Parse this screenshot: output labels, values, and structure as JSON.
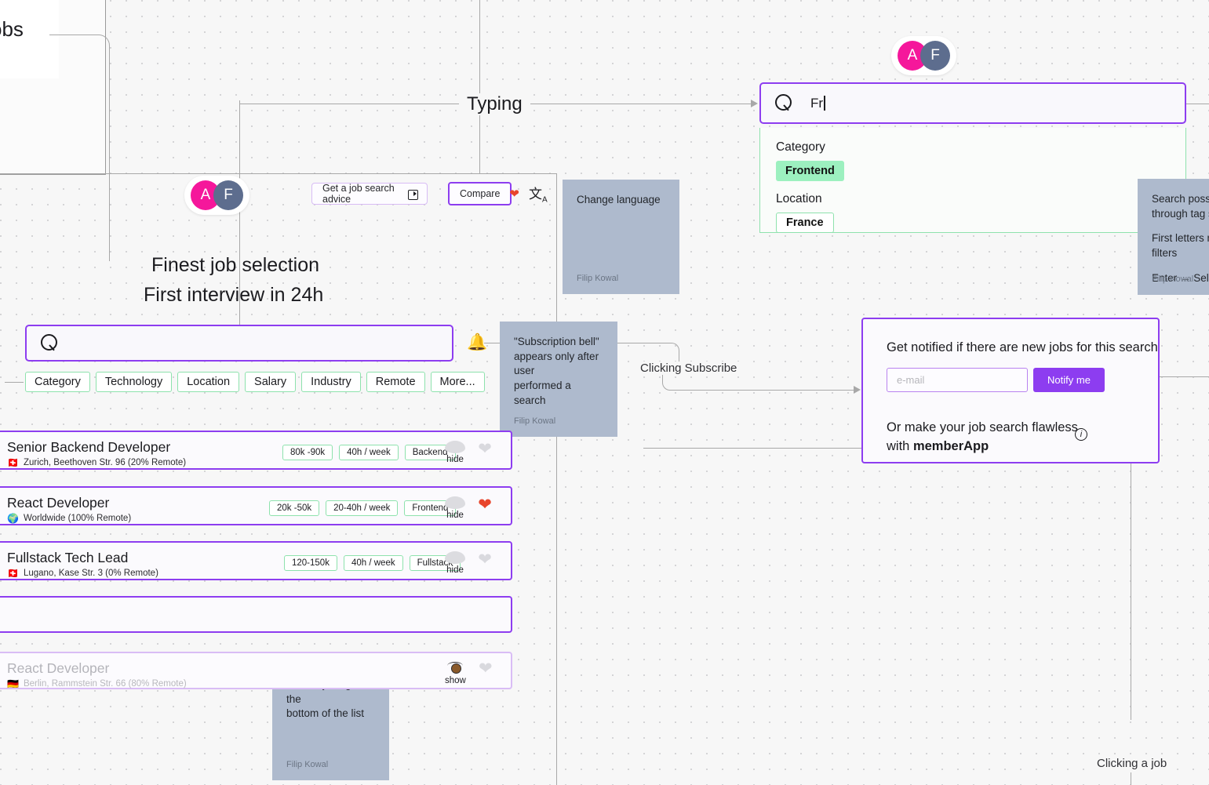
{
  "canvas": {
    "board_type": "design-whiteboard",
    "accent_purple": "#8d3df0",
    "accent_green": "#8ee2ad",
    "sticky_color": "#aebacd",
    "background": "#f7f7f7"
  },
  "corner_card": {
    "text": "obs"
  },
  "flow_labels": {
    "typing": "Typing",
    "clicking_subscribe": "Clicking Subscribe",
    "clicking_a_job": "Clicking a job"
  },
  "avatars": {
    "top": [
      {
        "initial": "A",
        "color": "#f5179b"
      },
      {
        "initial": "F",
        "color": "#5d6d8e"
      }
    ],
    "left": [
      {
        "initial": "A",
        "color": "#f5179b"
      },
      {
        "initial": "F",
        "color": "#5d6d8e"
      }
    ]
  },
  "top_search": {
    "icon": "search-icon",
    "value": "Fr",
    "suggestions": [
      {
        "group": "Category",
        "tag": "Frontend",
        "style": "filled"
      },
      {
        "group": "Location",
        "tag": "France",
        "style": "outline"
      }
    ]
  },
  "headline": {
    "line1": "Finest job selection",
    "line2": "First interview in 24h"
  },
  "toolbar": {
    "advice_label": "Get a job search advice",
    "advice_icon": "video-icon",
    "compare_label": "Compare",
    "compare_icon": "heart-icon",
    "translate_icon": "translate-icon"
  },
  "main_search": {
    "icon": "search-icon",
    "value": "",
    "placeholder": ""
  },
  "filter_chips": [
    "Category",
    "Technology",
    "Location",
    "Salary",
    "Industry",
    "Remote",
    "More..."
  ],
  "bell": {
    "icon": "bell-icon"
  },
  "jobs": [
    {
      "title": "Senior Backend Developer",
      "flag": "🇨🇭",
      "location": "Zurich, Beethoven Str. 96 (20% Remote)",
      "tags": [
        "80k -90k",
        "40h / week",
        "Backend"
      ],
      "action_label": "hide",
      "action_icon": "eye-closed-icon",
      "favorite": false,
      "hidden": false
    },
    {
      "title": "React Developer",
      "flag": "🌍",
      "location": "Worldwide (100% Remote)",
      "tags": [
        "20k -50k",
        "20-40h / week",
        "Frontend"
      ],
      "action_label": "hide",
      "action_icon": "eye-closed-icon",
      "favorite": true,
      "hidden": false
    },
    {
      "title": "Fullstack Tech Lead",
      "flag": "🇨🇭",
      "location": "Lugano, Kase Str. 3 (0% Remote)",
      "tags": [
        "120-150k",
        "40h / week",
        "Fullstack"
      ],
      "action_label": "hide",
      "action_icon": "eye-closed-icon",
      "favorite": false,
      "hidden": false
    },
    {
      "title": "",
      "flag": "",
      "location": "",
      "tags": [],
      "action_label": "",
      "action_icon": "",
      "favorite": false,
      "hidden": false,
      "empty": true
    },
    {
      "title": "React Developer",
      "flag": "🇩🇪",
      "location": "Berlin, Rammstein Str. 66 (80% Remote)",
      "tags": [],
      "action_label": "show",
      "action_icon": "eye-open-icon",
      "favorite": false,
      "hidden": true
    }
  ],
  "notify_panel": {
    "title": "Get notified if there are new jobs for this search",
    "email_placeholder": "e-mail",
    "email_value": "",
    "button_label": "Notify me",
    "sub_line1": "Or make your job search flawless",
    "sub_line2_prefix": "with ",
    "sub_line2_strong": "memberApp",
    "info_icon": "info-icon"
  },
  "stickies": {
    "change_language": {
      "lines": [
        "Change language"
      ],
      "author": "Filip Kowal"
    },
    "subscription_bell": {
      "lines": [
        "\"Subscription bell\"",
        "appears only after user",
        "performed a search"
      ],
      "author": "Filip Kowal"
    },
    "search_help": {
      "lines": [
        "Search possible",
        "through tag selec",
        "First letters match",
        "filters",
        "Enter → Selects f"
      ],
      "author": "Filip Kowal"
    },
    "hidden_jobs": {
      "lines": [
        "Hidden jobs go to the",
        "bottom of the list"
      ],
      "author": "Filip Kowal"
    }
  }
}
